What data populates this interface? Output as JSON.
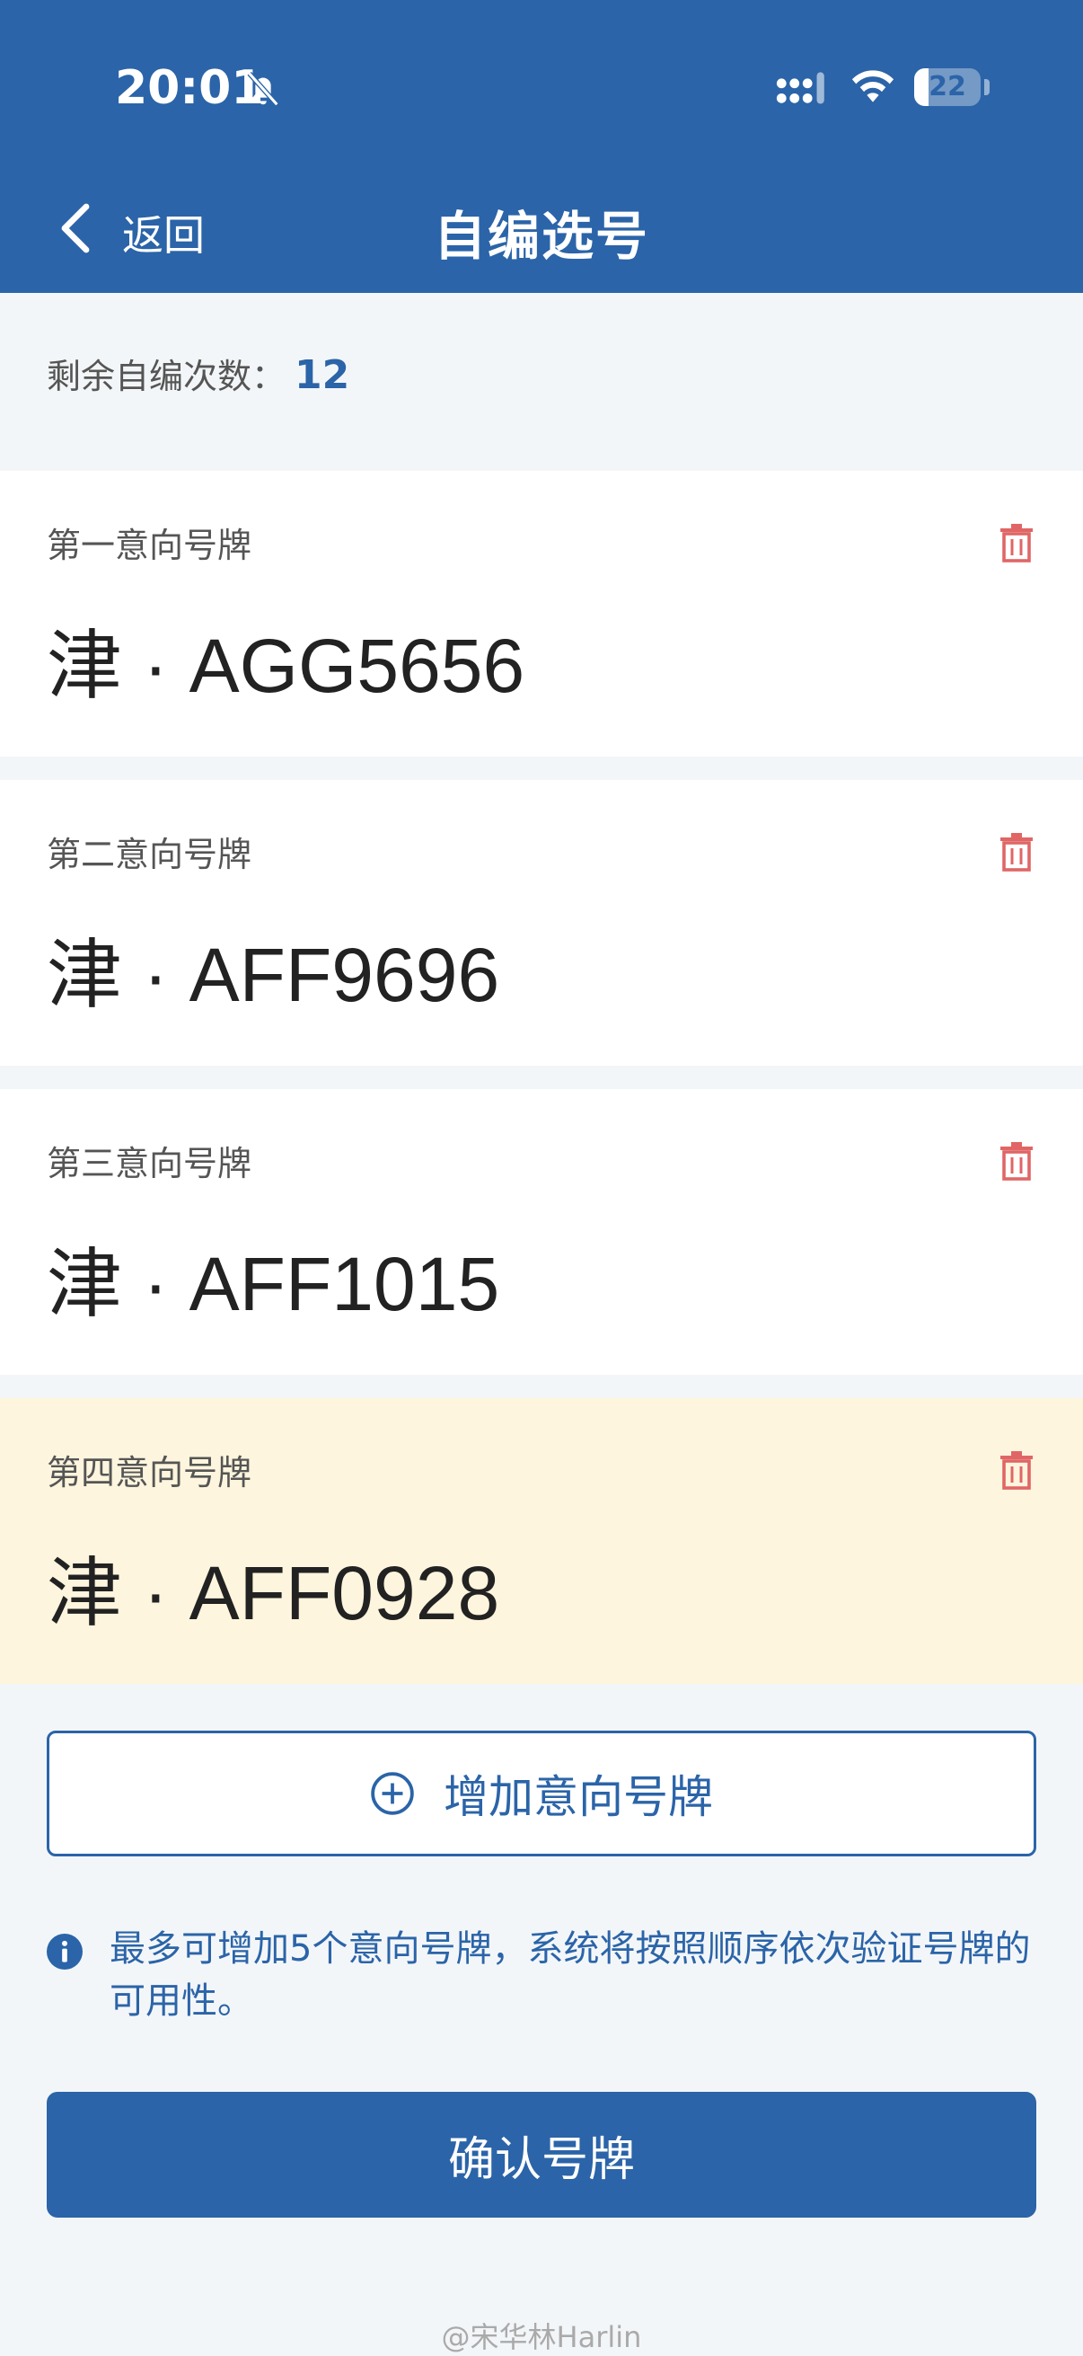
{
  "status_bar": {
    "time": "20:01",
    "battery": "22",
    "battery_level": 0.22
  },
  "nav": {
    "back_label": "返回",
    "title": "自编选号"
  },
  "remaining": {
    "label": "剩余自编次数：",
    "count": "12"
  },
  "cards": [
    {
      "label": "第一意向号牌",
      "plate": "津 · AGG5656"
    },
    {
      "label": "第二意向号牌",
      "plate": "津 · AFF9696"
    },
    {
      "label": "第三意向号牌",
      "plate": "津 · AFF1015"
    },
    {
      "label": "第四意向号牌",
      "plate": "津 · AFF0928"
    }
  ],
  "add_button": {
    "label": "增加意向号牌"
  },
  "info": {
    "text": "最多可增加5个意向号牌，系统将按照顺序依次验证号牌的可用性。"
  },
  "confirm_button": {
    "label": "确认号牌"
  },
  "watermark": "@宋华林Harlin",
  "colors": {
    "primary": "#2b64a8",
    "highlight": "#fdf5dd",
    "danger": "#e06666"
  }
}
